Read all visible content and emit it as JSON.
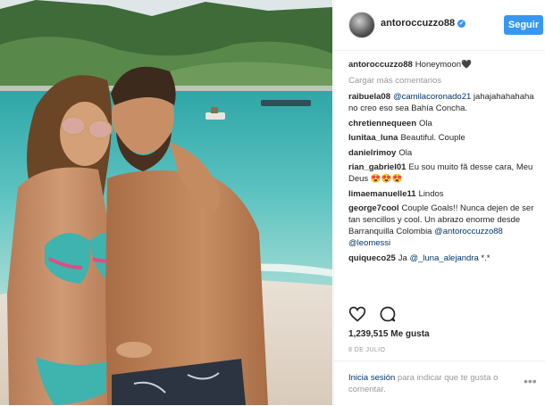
{
  "post": {
    "image_alt": "Couple posing on a tropical beach",
    "author": "antoroccuzzo88",
    "follow_label": "Seguir",
    "caption": {
      "user": "antoroccuzzo88",
      "text": "Honeymoon🖤"
    },
    "load_more": "Cargar más comentarios",
    "comments": [
      {
        "user": "raibuela08",
        "mention": "@camilacoronado21",
        "text": "jahajahahahaha no creo eso sea Bahía Concha."
      },
      {
        "user": "chretiennequeen",
        "text": "Ola"
      },
      {
        "user": "lunitaa_luna",
        "text": "Beautiful. Couple"
      },
      {
        "user": "danielrimoy",
        "text": "Ola"
      },
      {
        "user": "rian_gabriel01",
        "text": "Eu sou muito fã desse cara, Meu Deus 😍😍😍"
      },
      {
        "user": "limaemanuelle11",
        "text": "Lindos"
      },
      {
        "user": "george7cool",
        "text": "Couple Goals!! Nunca dejen de ser tan sencillos y cool. Un abrazo enorme desde Barranquilla Colombia",
        "mentions": [
          "@antoroccuzzo88",
          "@leomessi"
        ]
      },
      {
        "user": "quiqueco25",
        "text_before": "Ja",
        "mention": "@_luna_alejandra",
        "text_after": "*.*"
      }
    ],
    "likes": "1,239,515 Me gusta",
    "date": "8 DE JULIO",
    "login_link": "Inicia sesión",
    "login_text": "para indicar que te gusta o comentar.",
    "more_options": "•••"
  },
  "colors": {
    "accent": "#3897f0",
    "link": "#003569",
    "muted": "#999999",
    "sea": "#4fb6b4",
    "sky": "#dfe6e8"
  },
  "icons": [
    "verified-badge-icon",
    "heart-icon",
    "comment-icon",
    "more-options-icon"
  ]
}
